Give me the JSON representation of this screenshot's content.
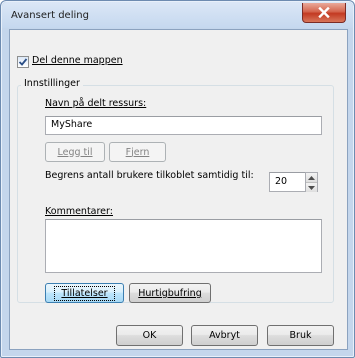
{
  "window": {
    "title": "Avansert deling"
  },
  "share_checkbox": {
    "label": "Del denne mappen",
    "checked": true
  },
  "settings": {
    "group_label": "Innstillinger",
    "share_name_label": "Navn på delt ressurs:",
    "share_name_value": "MyShare",
    "add_button": "Legg til",
    "remove_button": "Fjern",
    "limit_label": "Begrens antall brukere tilkoblet samtidig til:",
    "limit_value": "20",
    "comments_label": "Kommentarer:",
    "comments_value": "",
    "permissions_button": "Tillatelser",
    "caching_button": "Hurtigbufring"
  },
  "footer": {
    "ok_button": "OK",
    "cancel_button": "Avbryt",
    "apply_button": "Bruk"
  },
  "colors": {
    "accent": "#3c7fb1",
    "close": "#c33a22"
  }
}
